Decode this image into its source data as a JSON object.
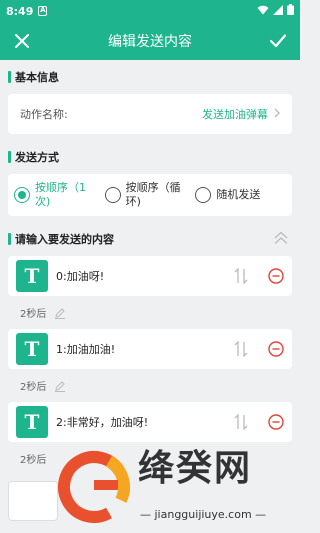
{
  "status": {
    "time": "8:49",
    "notif_letter": "A"
  },
  "toolbar": {
    "title": "编辑发送内容"
  },
  "basic": {
    "section_title": "基本信息",
    "action_label": "动作名称:",
    "action_value": "发送加油弹幕"
  },
  "send_mode": {
    "section_title": "发送方式",
    "options": [
      {
        "label_line1": "按顺序（1",
        "label_line2": "次)",
        "checked": true
      },
      {
        "label_line1": "按顺序（循",
        "label_line2": "环)",
        "checked": false
      },
      {
        "label_line1": "随机发送",
        "label_line2": "",
        "checked": false
      }
    ]
  },
  "content": {
    "section_title": "请输入要发送的内容",
    "items": [
      {
        "icon_letter": "T",
        "text": "0:加油呀!"
      },
      {
        "icon_letter": "T",
        "text": "1:加油加油!"
      },
      {
        "icon_letter": "T",
        "text": "2:非常好，加油呀!"
      }
    ],
    "delays": [
      "2秒后",
      "2秒后",
      "2秒后"
    ]
  },
  "watermark": {
    "brand": "绛癸网",
    "url": "— jiangguijiuye.com —"
  },
  "colors": {
    "accent": "#1eb58e",
    "danger": "#e0443a"
  }
}
